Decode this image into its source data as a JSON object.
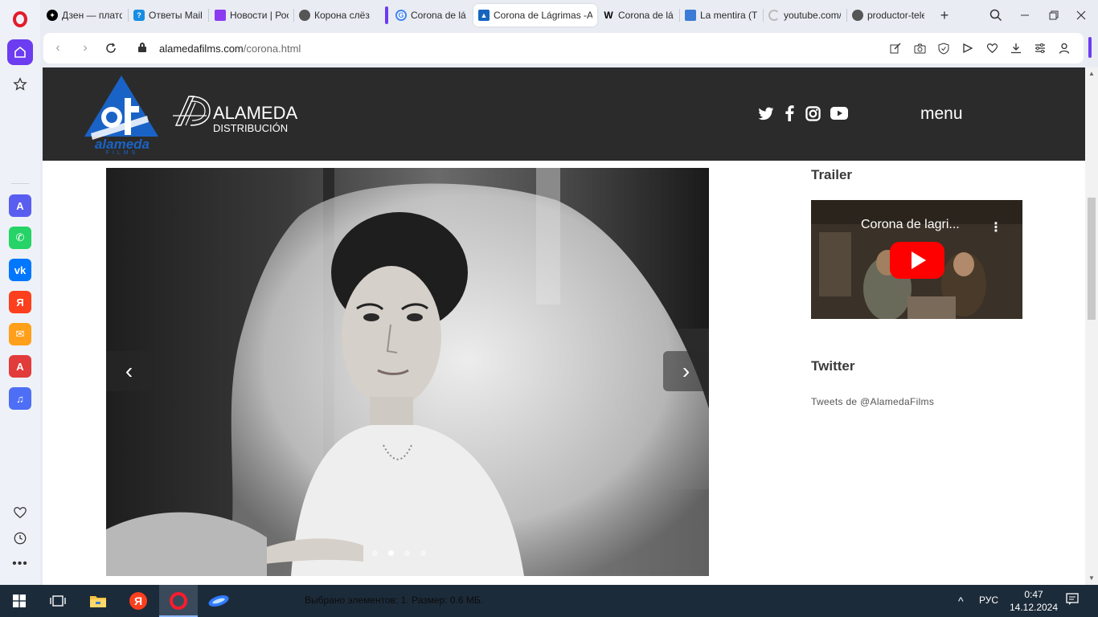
{
  "browser": {
    "tabs": [
      {
        "title": "Дзен — платф",
        "favicon": "dzen-icon",
        "color": "#000000"
      },
      {
        "title": "Ответы Mail.r",
        "favicon": "mail-answers-icon",
        "color": "#168de2"
      },
      {
        "title": "Новости | Рос",
        "favicon": "news-icon",
        "color": "#8b3cf0"
      },
      {
        "title": "Корона слёз",
        "favicon": "globe-icon",
        "color": "#555555"
      },
      {
        "title": "Corona de lágr",
        "favicon": "google-icon",
        "color": "#4285f4"
      },
      {
        "title": "Corona de Lágrimas -Al",
        "favicon": "alameda-icon",
        "color": "#1565c0"
      },
      {
        "title": "Corona de lág",
        "favicon": "wikipedia-icon",
        "color": "#000000"
      },
      {
        "title": "La mentira (TV",
        "favicon": "image-icon",
        "color": "#3a7bd5"
      },
      {
        "title": "youtube.com/",
        "favicon": "loading-icon",
        "color": "#bbbbbb"
      },
      {
        "title": "productor-tele",
        "favicon": "globe-icon",
        "color": "#555555"
      }
    ],
    "new_tab_symbol": "+",
    "url": {
      "host": "alamedafilms.com",
      "path": "/corona.html"
    }
  },
  "site": {
    "logo_af_text": "alameda",
    "logo_af_sub": "FILMS",
    "logo_dist_name": "ALAMEDA",
    "logo_dist_sub": "DISTRIBUCIÓN",
    "menu_label": "menu",
    "carousel": {
      "prev": "‹",
      "next": "›",
      "slides": 4,
      "active_slide": 2
    },
    "trailer_heading": "Trailer",
    "video_title": "Corona de lagri...",
    "twitter_heading": "Twitter",
    "tweets_text": "Tweets de @AlamedaFilms"
  },
  "taskbar": {
    "status": "Выбрано элементов: 1. Размер: 0.6 МБ.",
    "language": "РУС",
    "time": "0:47",
    "date": "14.12.2024"
  },
  "colors": {
    "opera_red": "#e21b2b",
    "opera_accent": "#6c3cf0",
    "site_header": "#2b2b2b",
    "youtube_red": "#ff0000"
  }
}
